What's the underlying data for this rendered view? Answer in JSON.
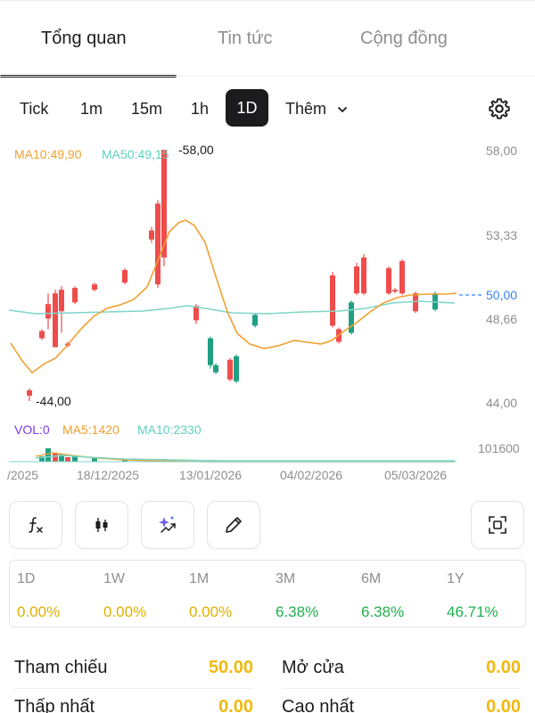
{
  "tabs": [
    {
      "label": "Tổng quan",
      "active": true
    },
    {
      "label": "Tin tức",
      "active": false
    },
    {
      "label": "Cộng đồng",
      "active": false
    }
  ],
  "intervals": {
    "items": [
      "Tick",
      "1m",
      "15m",
      "1h",
      "1D"
    ],
    "active": "1D",
    "more_label": "Thêm",
    "more_icon": "chevron-down-icon",
    "settings_icon": "gear-icon"
  },
  "chart": {
    "ma_legend": {
      "ma10": "MA10:49,90",
      "ma50": "MA50:49,15"
    },
    "price_axis": [
      "58,00",
      "53,33",
      "48,66",
      "44,00"
    ],
    "high_label": "58,00",
    "low_label": "44,00",
    "last_price": "50,00",
    "vol_legend": {
      "vol": "VOL:0",
      "ma5": "MA5:1420",
      "ma10": "MA10:2330"
    },
    "vol_axis": "101600",
    "dates": [
      "/2025",
      "18/12/2025",
      "13/01/2026",
      "04/02/2026",
      "05/03/2026"
    ],
    "colors": {
      "up": "#20a083",
      "down": "#ef4c4c",
      "ma10": "#f0a030",
      "ma50": "#7fd6c8",
      "last": "#3b82f6"
    }
  },
  "tools": [
    "function-icon",
    "candlestick-icon",
    "ai-sparkle-icon",
    "pencil-icon",
    "screenshot-icon"
  ],
  "performance": [
    {
      "period": "1D",
      "change": "0.00%",
      "color": "#e0b000"
    },
    {
      "period": "1W",
      "change": "0.00%",
      "color": "#e0b000"
    },
    {
      "period": "1M",
      "change": "0.00%",
      "color": "#e0b000"
    },
    {
      "period": "3M",
      "change": "6.38%",
      "color": "#1fb14c"
    },
    {
      "period": "6M",
      "change": "6.38%",
      "color": "#1fb14c"
    },
    {
      "period": "1Y",
      "change": "46.71%",
      "color": "#1fb14c"
    }
  ],
  "stats": {
    "reference_label": "Tham chiếu",
    "reference_value": "50.00",
    "open_label": "Mở cửa",
    "open_value": "0.00",
    "low_label": "Thấp nhất",
    "low_value": "0.00",
    "high_label": "Cao nhất",
    "high_value": "0.00"
  }
}
